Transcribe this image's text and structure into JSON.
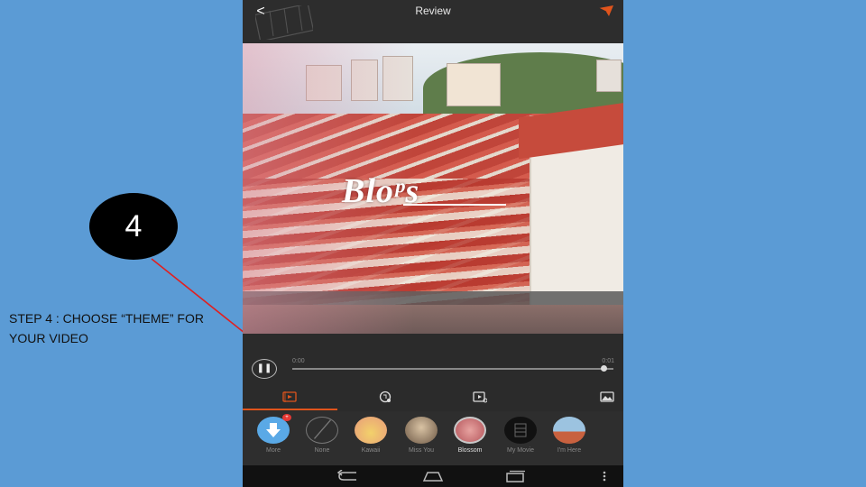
{
  "annotation": {
    "step_number": "4",
    "instruction": "STEP 4 : CHOOSE “THEME” FOR YOUR VIDEO"
  },
  "app": {
    "title": "Review",
    "back_icon": "back-arrow-icon",
    "send_icon": "send-icon"
  },
  "preview": {
    "overlay_text": "Bloᵖs"
  },
  "player": {
    "time_current": "0:00",
    "time_total": "0:01",
    "progress": 0.97
  },
  "tabs": [
    {
      "name": "theme",
      "icon": "theme-icon",
      "active": true
    },
    {
      "name": "music",
      "icon": "music-icon",
      "active": false
    },
    {
      "name": "edit",
      "icon": "clip-edit-icon",
      "active": false
    },
    {
      "name": "photo",
      "icon": "photo-icon",
      "active": false
    }
  ],
  "themes": [
    {
      "label": "More",
      "color": "#5aa9e6",
      "badge": "+"
    },
    {
      "label": "None",
      "color": "#2e2e2e"
    },
    {
      "label": "Kawaii",
      "color": "#f2d16b"
    },
    {
      "label": "Miss You",
      "color": "#b98b6a"
    },
    {
      "label": "Blossom",
      "color": "#c96a6f",
      "selected": true
    },
    {
      "label": "My Movie",
      "color": "#111111"
    },
    {
      "label": "I'm Here",
      "color": "#9cc3e0"
    }
  ],
  "colors": {
    "background": "#5b9bd5",
    "accent": "#e0541c",
    "arrow": "#e02020"
  }
}
